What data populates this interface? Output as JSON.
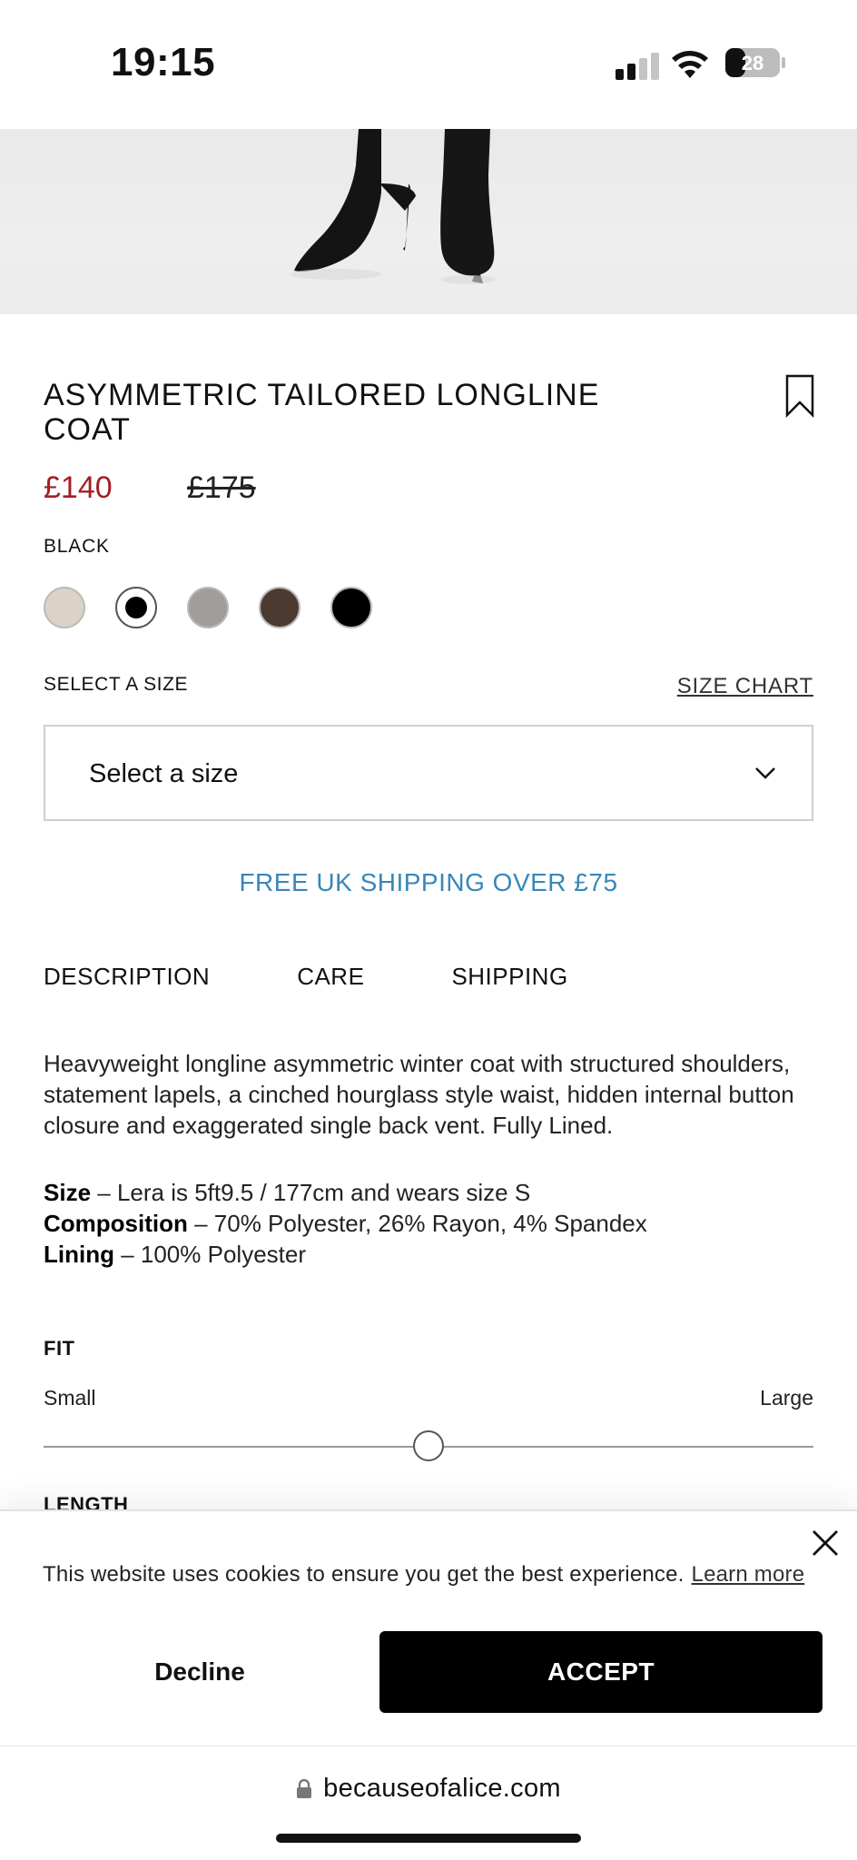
{
  "status_bar": {
    "time": "19:15",
    "battery_level": "28",
    "icons": [
      "signal-icon",
      "wifi-icon",
      "battery-icon"
    ]
  },
  "product": {
    "title": "ASYMMETRIC TAILORED LONGLINE COAT",
    "price_sale": "£140",
    "price_original": "£175",
    "selected_color": "BLACK",
    "colors": [
      {
        "name": "cream",
        "hex": "#dcd3c6"
      },
      {
        "name": "black",
        "hex": "#000000",
        "selected": true
      },
      {
        "name": "grey",
        "hex": "#a09e9c"
      },
      {
        "name": "brown",
        "hex": "#4a3a30"
      },
      {
        "name": "black-solid",
        "hex": "#000000"
      }
    ],
    "sale_color": "#a31f24"
  },
  "size": {
    "label": "SELECT A SIZE",
    "chart_link": "SIZE CHART",
    "dropdown_value": "Select a size"
  },
  "promo": {
    "shipping": "FREE UK SHIPPING OVER £75",
    "color": "#3a86b8"
  },
  "tabs": [
    {
      "label": "DESCRIPTION"
    },
    {
      "label": "CARE"
    },
    {
      "label": "SHIPPING"
    }
  ],
  "description": {
    "text": "Heavyweight longline asymmetric winter coat with structured shoulders, statement lapels, a cinched hourglass style waist, hidden internal button closure and exaggerated single back vent. Fully Lined.",
    "specs": [
      {
        "key": "Size",
        "value": " – Lera is 5ft9.5 / 177cm and wears size S"
      },
      {
        "key": "Composition",
        "value": " – 70% Polyester, 26% Rayon, 4% Spandex"
      },
      {
        "key": "Lining",
        "value": " – 100% Polyester"
      }
    ]
  },
  "fit": {
    "heading": "FIT",
    "min_label": "Small",
    "max_label": "Large",
    "value": 0.5,
    "next_heading": "LENGTH"
  },
  "cookie_banner": {
    "message": "This website uses cookies to ensure you get the best experience.",
    "learn_more": "Learn more",
    "decline_label": "Decline",
    "accept_label": "ACCEPT"
  },
  "browser": {
    "url": "becauseofalice.com"
  }
}
